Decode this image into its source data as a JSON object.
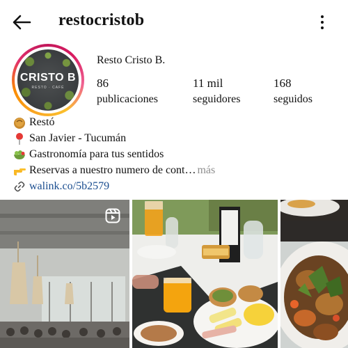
{
  "header": {
    "username": "restocristob",
    "back_icon": "arrow-left-icon",
    "menu_icon": "more-vertical-icon"
  },
  "profile": {
    "avatar_logo": "CRISTO B",
    "avatar_logo_sub": "RESTO · CAFÉ",
    "display_name": "Resto Cristo B.",
    "stats": [
      {
        "value": "86",
        "label": "publicaciones"
      },
      {
        "value": "11 mil",
        "label": "seguidores"
      },
      {
        "value": "168",
        "label": "seguidos"
      }
    ]
  },
  "bio": {
    "lines": [
      {
        "icon": "food-bowl-icon",
        "text": "Restó"
      },
      {
        "icon": "map-pin-icon",
        "text": "San Javier - Tucumán"
      },
      {
        "icon": "salad-icon",
        "text": "Gastronomía para tus sentidos"
      },
      {
        "icon": "pointing-hand-icon",
        "text": "Reservas a nuestro numero de cont…",
        "more": "más"
      }
    ],
    "link": {
      "icon": "link-icon",
      "text": "walink.co/5b2579"
    }
  },
  "posts": [
    {
      "type": "reel",
      "subject": "restaurant-interior",
      "badge_icon": "reels-icon"
    },
    {
      "type": "photo",
      "subject": "breakfast-table"
    },
    {
      "type": "photo",
      "subject": "plated-dish"
    }
  ],
  "colors": {
    "link": "#1a4d8f",
    "muted": "#8e8e8e",
    "story_ring": [
      "#f9a825",
      "#e1306c",
      "#c2185b"
    ]
  }
}
